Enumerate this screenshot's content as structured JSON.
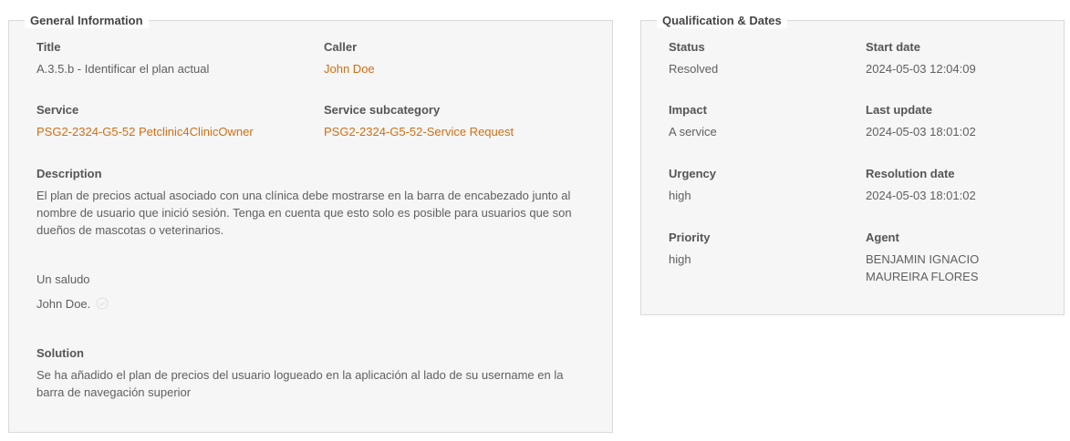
{
  "general": {
    "legend": "General Information",
    "title_label": "Title",
    "title_value": "A.3.5.b - Identificar el plan actual",
    "caller_label": "Caller",
    "caller_value": "John Doe",
    "service_label": "Service",
    "service_value": "PSG2-2324-G5-52 Petclinic4ClinicOwner",
    "subcategory_label": "Service subcategory",
    "subcategory_value": "PSG2-2324-G5-52-Service Request",
    "description_label": "Description",
    "description_value": "El plan de precios actual asociado con una clínica debe mostrarse en la barra de encabezado junto al nombre de usuario que inició sesión. Tenga en cuenta que esto solo es posible para usuarios que son dueños de mascotas o veterinarios.",
    "greeting": "Un saludo",
    "signature": "John Doe.",
    "solution_label": "Solution",
    "solution_value": "Se ha añadido el plan de precios del usuario logueado en la aplicación al lado de su username en la barra de navegación superior"
  },
  "qualification": {
    "legend": "Qualification & Dates",
    "status_label": "Status",
    "status_value": "Resolved",
    "start_label": "Start date",
    "start_value": "2024-05-03 12:04:09",
    "impact_label": "Impact",
    "impact_value": "A service",
    "last_update_label": "Last update",
    "last_update_value": "2024-05-03 18:01:02",
    "urgency_label": "Urgency",
    "urgency_value": "high",
    "resolution_label": "Resolution date",
    "resolution_value": "2024-05-03 18:01:02",
    "priority_label": "Priority",
    "priority_value": "high",
    "agent_label": "Agent",
    "agent_value": "BENJAMIN IGNACIO MAUREIRA FLORES"
  },
  "colors": {
    "link": "#d16e12",
    "panel_bg": "#f6f6f6",
    "border": "#d9d9d9"
  },
  "icons": {
    "signature_icon": "check-badge-icon"
  }
}
